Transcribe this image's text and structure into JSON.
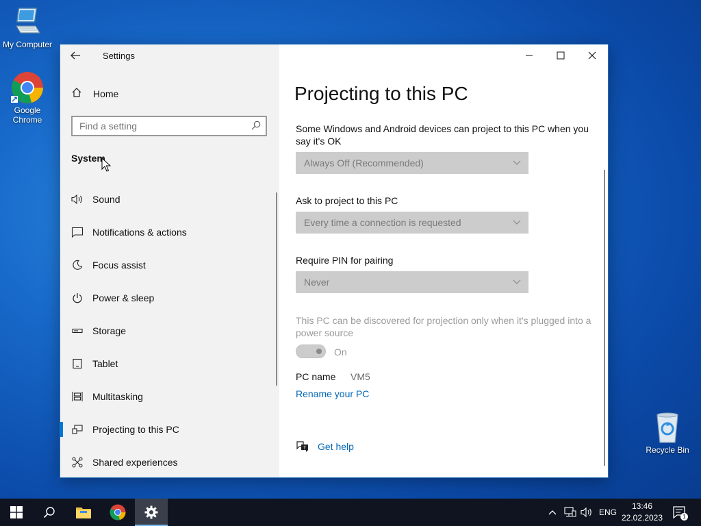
{
  "desktop": {
    "icons": [
      {
        "label": "My Computer"
      },
      {
        "label": "Google Chrome"
      },
      {
        "label": "Recycle Bin"
      }
    ]
  },
  "window": {
    "title": "Settings",
    "nav": {
      "home_label": "Home",
      "search_placeholder": "Find a setting",
      "section_title": "System",
      "items": [
        {
          "label": "Sound",
          "icon": "speaker-icon"
        },
        {
          "label": "Notifications & actions",
          "icon": "notification-icon"
        },
        {
          "label": "Focus assist",
          "icon": "moon-icon"
        },
        {
          "label": "Power & sleep",
          "icon": "power-icon"
        },
        {
          "label": "Storage",
          "icon": "storage-icon"
        },
        {
          "label": "Tablet",
          "icon": "tablet-icon"
        },
        {
          "label": "Multitasking",
          "icon": "multitasking-icon"
        },
        {
          "label": "Projecting to this PC",
          "icon": "projecting-icon",
          "selected": true
        },
        {
          "label": "Shared experiences",
          "icon": "shared-experiences-icon"
        }
      ]
    },
    "content": {
      "page_title": "Projecting to this PC",
      "project_desc": "Some Windows and Android devices can project to this PC when you say it's OK",
      "project_value": "Always Off (Recommended)",
      "ask_label": "Ask to project to this PC",
      "ask_value": "Every time a connection is requested",
      "pin_label": "Require PIN for pairing",
      "pin_value": "Never",
      "power_desc": "This PC can be discovered for projection only when it's plugged into a power source",
      "toggle_state": "On",
      "pc_name_label": "PC name",
      "pc_name_value": "VM5",
      "rename_link": "Rename your PC",
      "help_link": "Get help"
    }
  },
  "taskbar": {
    "language": "ENG",
    "time": "13:46",
    "date": "22.02.2023",
    "notification_count": "1"
  },
  "colors": {
    "accent": "#0078d7",
    "link": "#0066b4",
    "taskbar": "#0f1420"
  }
}
